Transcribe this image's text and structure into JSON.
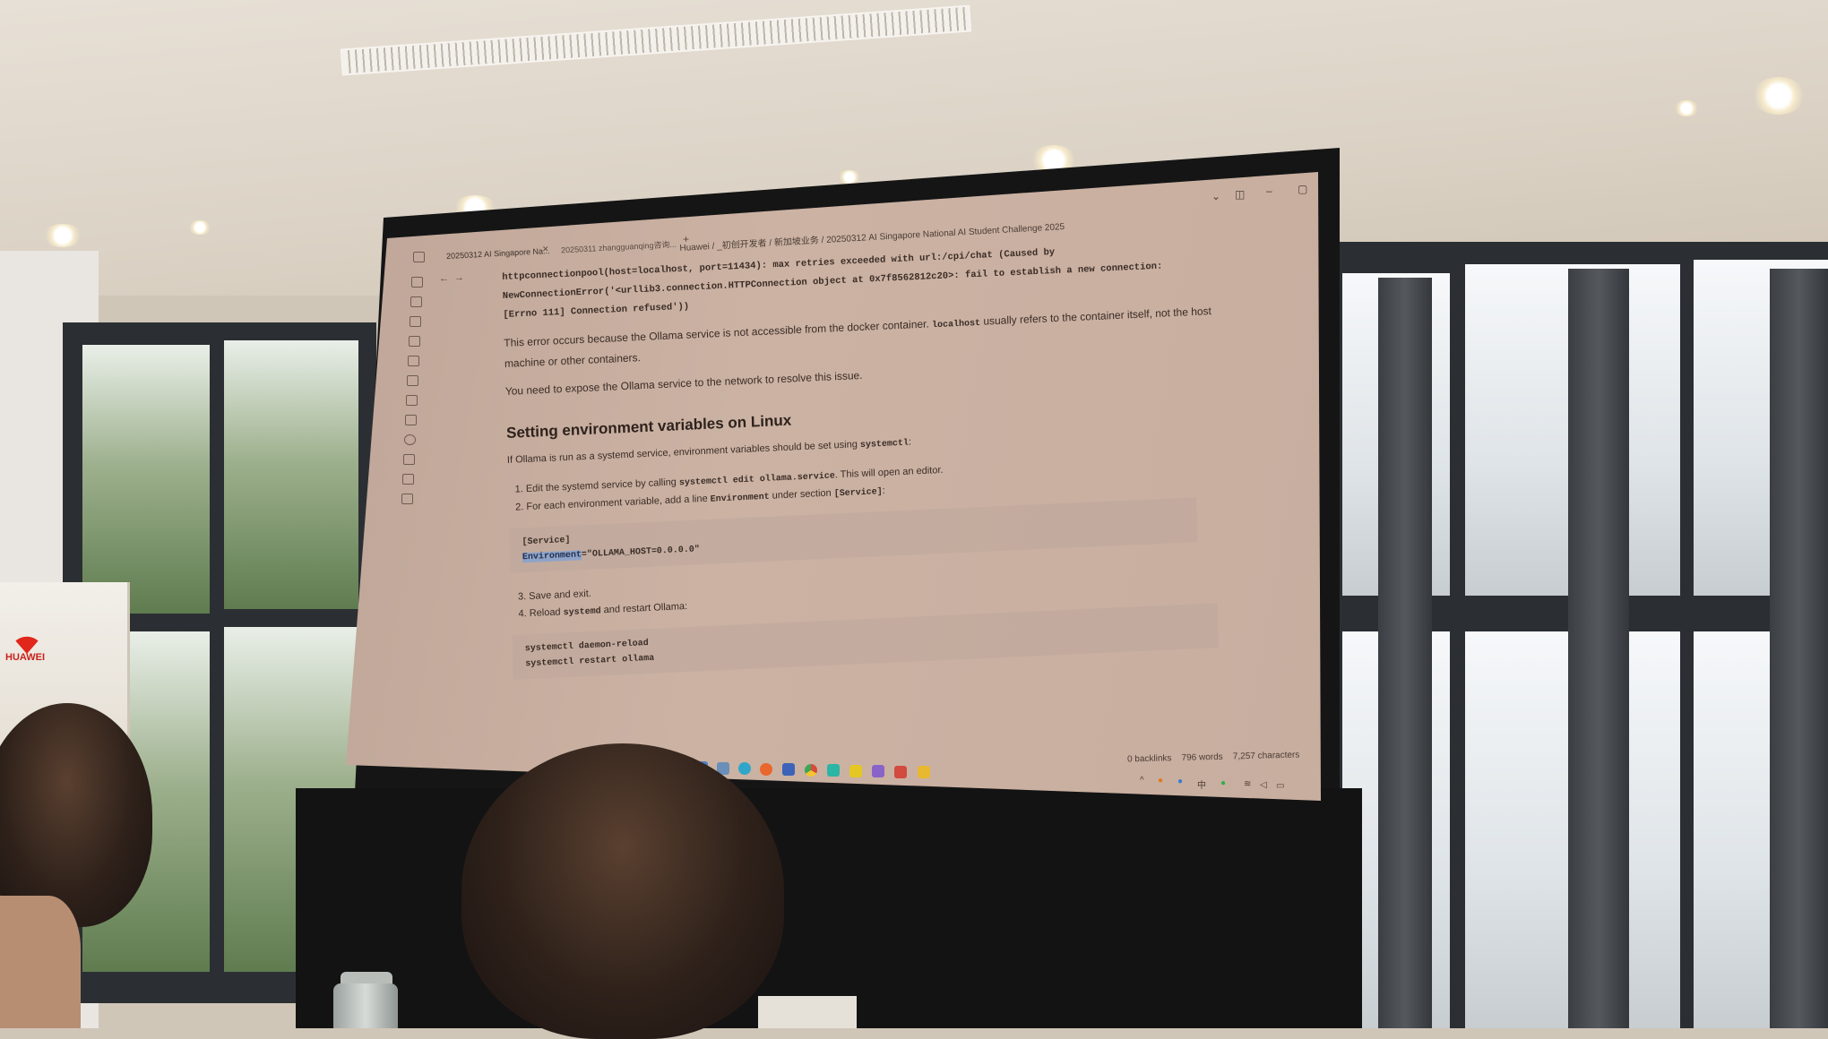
{
  "tabs": [
    {
      "label": "20250312 AI Singapore Na...",
      "active": true
    },
    {
      "label": "20250311 zhangguanqing咨询...",
      "active": false
    }
  ],
  "breadcrumb": "Huawei / _初创开发者 / 新加坡业务 / 20250312 AI Singapore National AI Student Challenge 2025",
  "document": {
    "error_lines": [
      "httpconnectionpool(host=localhost, port=11434): max retries exceeded with url:/cpi/chat (Caused by",
      "NewConnectionError('<urllib3.connection.HTTPConnection object at 0x7f8562812c20>: fail to establish a new connection:",
      "[Errno 111] Connection refused'))"
    ],
    "para1_a": "This error occurs because the Ollama service is not accessible from the docker container.",
    "para1_code": "localhost",
    "para1_b": "usually refers to the container itself, not the host machine or other containers.",
    "para2": "You need to expose the Ollama service to the network to resolve this issue.",
    "heading": "Setting environment variables on Linux",
    "intro_a": "If Ollama is run as a systemd service, environment variables should be set using",
    "intro_code": "systemctl",
    "intro_b": ":",
    "step1_a": "Edit the systemd service by calling",
    "step1_code": "systemctl edit ollama.service",
    "step1_b": ". This will open an editor.",
    "step2_a": "For each environment variable, add a line",
    "step2_code1": "Environment",
    "step2_b": "under section",
    "step2_code2": "[Service]",
    "step2_c": ":",
    "block1_line1": "[Service]",
    "block1_env": "Environment",
    "block1_rest": "=\"OLLAMA_HOST=0.0.0.0\"",
    "step3": "Save and exit.",
    "step4_a": "Reload",
    "step4_code": "systemd",
    "step4_b": "and restart Ollama:",
    "block2": [
      "systemctl daemon-reload",
      "systemctl restart ollama"
    ]
  },
  "statusbar": {
    "backlinks": "0 backlinks",
    "words": "796 words",
    "characters": "7,257 characters"
  },
  "banner": {
    "brand": "HUAWEI"
  },
  "colors": {
    "screen": "#c8ae9f",
    "highlight": "#8fa3c9",
    "frame": "#151515"
  }
}
